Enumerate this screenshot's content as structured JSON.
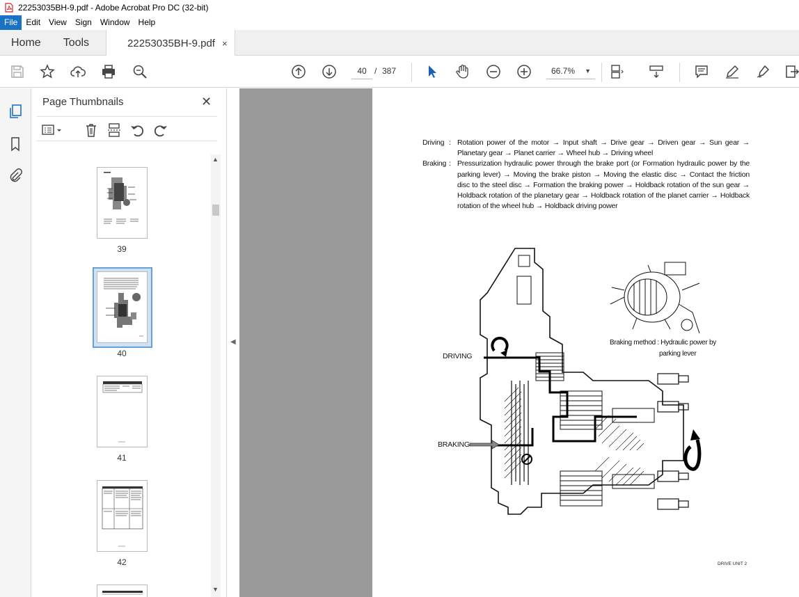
{
  "window": {
    "title": "22253035BH-9.pdf - Adobe Acrobat Pro DC (32-bit)"
  },
  "menu": [
    "File",
    "Edit",
    "View",
    "Sign",
    "Window",
    "Help"
  ],
  "tabs": {
    "home": "Home",
    "tools": "Tools",
    "document": "22253035BH-9.pdf",
    "close_glyph": "×"
  },
  "toolbar": {
    "current_page": "40",
    "page_separator": "/",
    "total_pages": "387",
    "zoom": "66.7%"
  },
  "thumbnails_panel": {
    "title": "Page Thumbnails",
    "close_glyph": "✕",
    "pages": [
      {
        "label": "39"
      },
      {
        "label": "40",
        "selected": true
      },
      {
        "label": "41"
      },
      {
        "label": "42"
      }
    ]
  },
  "document": {
    "definitions": [
      {
        "term": "Driving",
        "colon": ":",
        "text": "Rotation power of the motor → Input shaft → Drive gear → Driven gear → Sun gear → Planetary gear → Planet carrier → Wheel hub → Driving wheel"
      },
      {
        "term": "Braking",
        "colon": ":",
        "text": "Pressurization hydraulic power through the brake port (or Formation hydraulic power by the parking lever) → Moving the brake piston → Moving the elastic disc → Contact the friction disc to the steel disc → Formation the braking power → Holdback rotation of the sun gear → Holdback rotation of the planetary gear → Holdback rotation of the planet carrier → Holdback rotation of the wheel hub → Holdback driving power"
      }
    ],
    "figure": {
      "label_driving": "DRIVING",
      "label_braking": "BRAKING",
      "braking_method_line1": "Braking method : Hydraulic power by",
      "braking_method_line2": "parking lever",
      "figure_id": "DRIVE UNIT 2"
    }
  },
  "colors": {
    "accent": "#1a72c7",
    "viewer_background": "#9a9a9a",
    "selected_thumb": "#cfe2f5"
  }
}
